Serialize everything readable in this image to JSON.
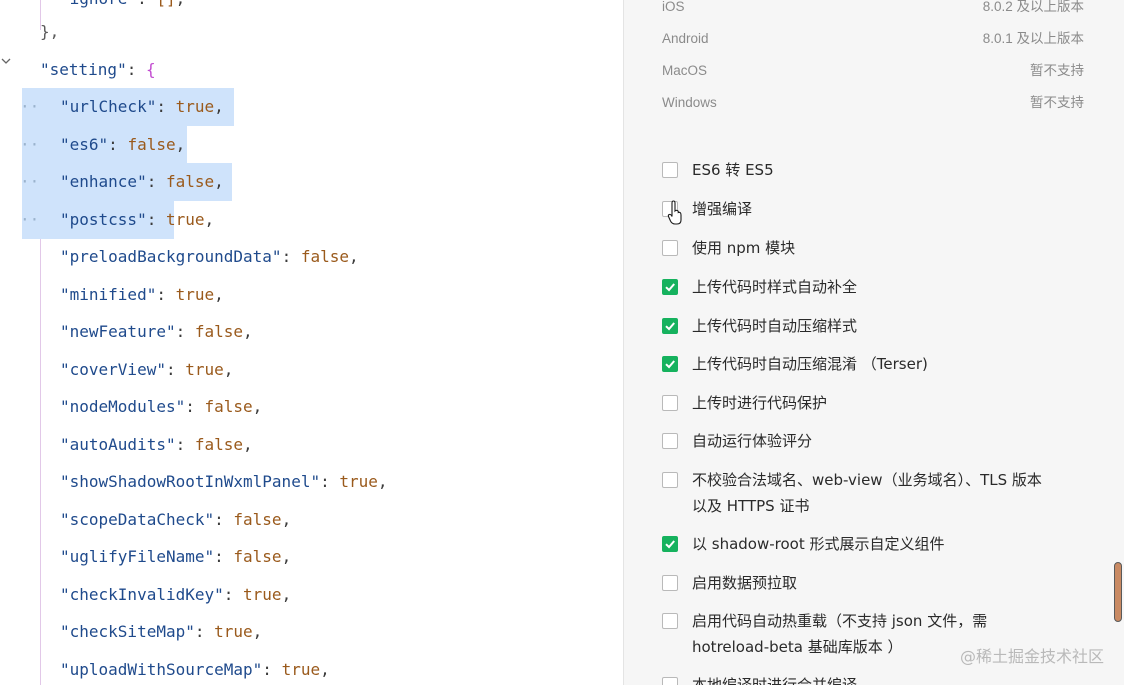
{
  "editor": {
    "lines": [
      {
        "key": "ignore",
        "value": "[]",
        "kind": "plain"
      },
      {
        "text": "},"
      },
      {
        "key": "setting",
        "open": "{"
      },
      {
        "key": "urlCheck",
        "value": "true",
        "selected": true
      },
      {
        "key": "es6",
        "value": "false",
        "selected": true
      },
      {
        "key": "enhance",
        "value": "false",
        "selected": true
      },
      {
        "key": "postcss",
        "value": "true",
        "selected": true
      },
      {
        "key": "preloadBackgroundData",
        "value": "false"
      },
      {
        "key": "minified",
        "value": "true"
      },
      {
        "key": "newFeature",
        "value": "false"
      },
      {
        "key": "coverView",
        "value": "true"
      },
      {
        "key": "nodeModules",
        "value": "false"
      },
      {
        "key": "autoAudits",
        "value": "false"
      },
      {
        "key": "showShadowRootInWxmlPanel",
        "value": "true"
      },
      {
        "key": "scopeDataCheck",
        "value": "false"
      },
      {
        "key": "uglifyFileName",
        "value": "false"
      },
      {
        "key": "checkInvalidKey",
        "value": "true"
      },
      {
        "key": "checkSiteMap",
        "value": "true"
      },
      {
        "key": "uploadWithSourceMap",
        "value": "true"
      }
    ]
  },
  "panel": {
    "versions": [
      {
        "platform": "iOS",
        "requirement": "8.0.2 及以上版本"
      },
      {
        "platform": "Android",
        "requirement": "8.0.1 及以上版本"
      },
      {
        "platform": "MacOS",
        "requirement": "暂不支持"
      },
      {
        "platform": "Windows",
        "requirement": "暂不支持"
      }
    ],
    "options": [
      {
        "label": "ES6 转 ES5",
        "checked": false
      },
      {
        "label": "增强编译",
        "checked": false
      },
      {
        "label": "使用 npm 模块",
        "checked": false
      },
      {
        "label": "上传代码时样式自动补全",
        "checked": true
      },
      {
        "label": "上传代码时自动压缩样式",
        "checked": true
      },
      {
        "label": "上传代码时自动压缩混淆 （Terser)",
        "checked": true
      },
      {
        "label": "上传时进行代码保护",
        "checked": false
      },
      {
        "label": "自动运行体验评分",
        "checked": false
      },
      {
        "label": "不校验合法域名、web-view（业务域名）、TLS 版本以及 HTTPS 证书",
        "checked": false
      },
      {
        "label": "以 shadow-root 形式展示自定义组件",
        "checked": true
      },
      {
        "label": "启用数据预拉取",
        "checked": false
      },
      {
        "label": "启用代码自动热重载（不支持 json 文件，需 hotreload-beta 基础库版本 ）",
        "checked": false
      },
      {
        "label": "本地编译时进行合并编译",
        "checked": false
      }
    ],
    "watermark": "@稀土掘金技术社区"
  },
  "colors": {
    "checked": "#16b25e",
    "selection": "#cfe3fb",
    "key": "#1f4a8c",
    "boolean": "#9a5a1c"
  }
}
